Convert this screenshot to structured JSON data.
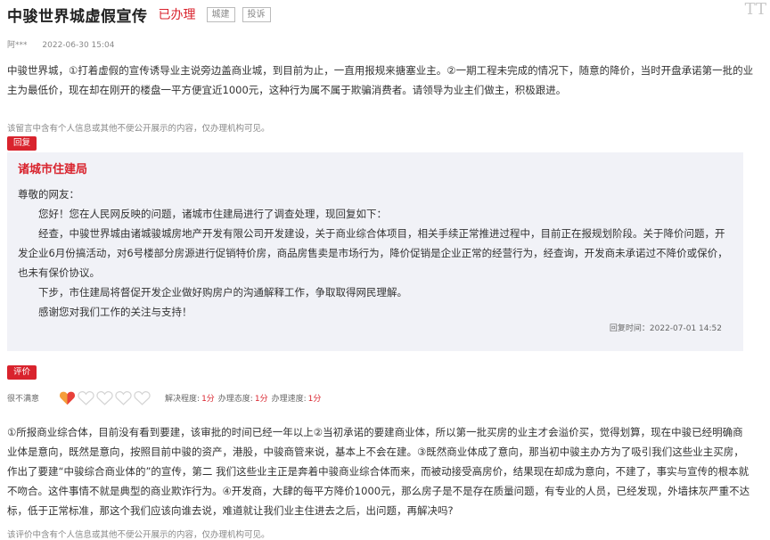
{
  "header": {
    "title": "中骏世界城虚假宣传",
    "status": "已办理",
    "tags": [
      "城建",
      "投诉"
    ],
    "font_toggle": "TT"
  },
  "meta": {
    "author": "阿***",
    "date": "2022-06-30 15:04"
  },
  "message": {
    "text": "中骏世界城，①打着虚假的宣传诱导业主说旁边盖商业城，到目前为止，一直用报规来搪塞业主。②一期工程未完成的情况下，随意的降价，当时开盘承诺第一批的业主为最低价，现在却在刚开的楼盘一平方便宜近1000元，这种行为属不属于欺骗消费者。请领导为业主们做主，积极跟进。",
    "privacy_notice": "该留言中含有个人信息或其他不便公开展示的内容，仅办理机构可见。"
  },
  "reply": {
    "badge": "回复",
    "org": "诸城市住建局",
    "greeting": "尊敬的网友：",
    "paragraphs": [
      "您好！您在人民网反映的问题，诸城市住建局进行了调查处理，现回复如下：",
      "经查，中骏世界城由诸城骏城房地产开发有限公司开发建设，关于商业综合体项目，相关手续正常推进过程中，目前正在报规划阶段。关于降价问题，开发企业6月份搞活动，对6号楼部分房源进行促销特价房，商品房售卖是市场行为，降价促销是企业正常的经营行为，经查询，开发商未承诺过不降价或保价，也未有保价协议。",
      "下步，市住建局将督促开发企业做好购房户的沟通解释工作，争取取得网民理解。",
      "感谢您对我们工作的关注与支持！"
    ],
    "time_label": "回复时间：2022-07-01 14:52"
  },
  "evaluation": {
    "badge": "评价",
    "overall": "很不满意",
    "hearts_total": 5,
    "hearts_filled": 1,
    "colors": {
      "heart_red": "#e8403a",
      "heart_orange": "#f59d3a",
      "heart_outline": "#d4d4d4"
    },
    "scores": [
      {
        "label": "解决程度:",
        "value": "1分"
      },
      {
        "label": "办理态度:",
        "value": "1分"
      },
      {
        "label": "办理速度:",
        "value": "1分"
      }
    ],
    "text": "①所报商业综合体，目前没有看到要建，该审批的时间已经一年以上②当初承诺的要建商业体，所以第一批买房的业主才会溢价买，觉得划算，现在中骏已经明确商业体是意向，既然是意向，按照目前中骏的资产，港股，中骏商管来说，基本上不会在建。③既然商业体成了意向，那当初中骏主办方为了吸引我们这些业主买房，作出了要建“中骏综合商业体的”的宣传，第二 我们这些业主正是奔着中骏商业综合体而来，而被动接受高房价，结果现在却成为意向，不建了，事实与宣传的根本就不吻合。这件事情不就是典型的商业欺诈行为。④开发商，大肆的每平方降价1000元，那么房子是不是存在质量问题，有专业的人员，已经发现，外墙抹灰严重不达标，低于正常标准，那这个我们应该向谁去说，难道就让我们业主住进去之后，出问题，再解决吗?",
    "privacy_notice": "该评价中含有个人信息或其他不便公开展示的内容，仅办理机构可见。"
  }
}
